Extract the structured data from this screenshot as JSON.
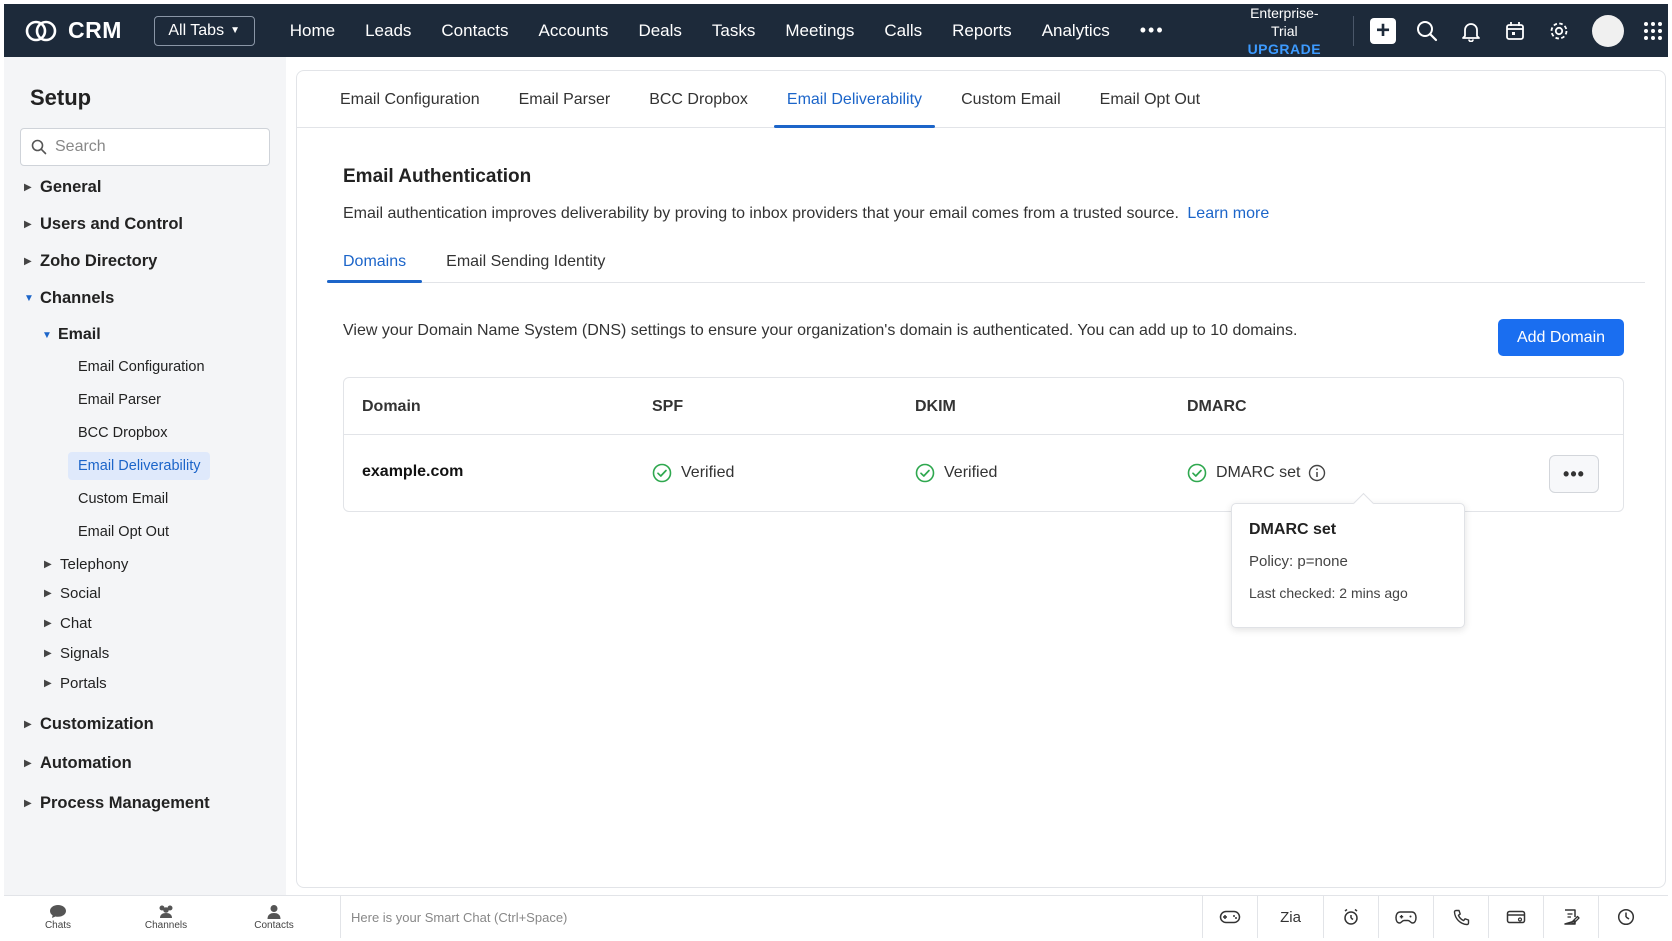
{
  "topbar": {
    "brand": "CRM",
    "all_tabs": "All Tabs",
    "nav": [
      "Home",
      "Leads",
      "Contacts",
      "Accounts",
      "Deals",
      "Tasks",
      "Meetings",
      "Calls",
      "Reports",
      "Analytics"
    ],
    "more": "•••",
    "trial_label": "Enterprise-Trial",
    "upgrade": "UPGRADE"
  },
  "sidebar": {
    "title": "Setup",
    "search_placeholder": "Search",
    "sections": {
      "general": "General",
      "users": "Users and Control",
      "directory": "Zoho Directory",
      "channels": "Channels",
      "email": "Email",
      "email_items": [
        "Email Configuration",
        "Email Parser",
        "BCC Dropbox",
        "Email Deliverability",
        "Custom Email",
        "Email Opt Out"
      ],
      "telephony": "Telephony",
      "social": "Social",
      "chat": "Chat",
      "signals": "Signals",
      "portals": "Portals",
      "customization": "Customization",
      "automation": "Automation",
      "process": "Process Management"
    }
  },
  "main": {
    "tabs": [
      "Email Configuration",
      "Email Parser",
      "BCC Dropbox",
      "Email Deliverability",
      "Custom Email",
      "Email Opt Out"
    ],
    "active_tab": "Email Deliverability",
    "auth_title": "Email Authentication",
    "auth_desc": "Email authentication improves deliverability by proving to inbox providers that your email comes from a trusted source.",
    "learn_more": "Learn more",
    "subtabs": [
      "Domains",
      "Email Sending Identity"
    ],
    "dns_desc": "View your Domain Name System (DNS) settings to ensure your organization's domain is authenticated. You can add up to 10 domains.",
    "add_domain": "Add Domain",
    "table": {
      "headers": [
        "Domain",
        "SPF",
        "DKIM",
        "DMARC"
      ],
      "row": {
        "domain": "example.com",
        "spf": "Verified",
        "dkim": "Verified",
        "dmarc": "DMARC set",
        "menu": "•••"
      }
    },
    "tooltip": {
      "title": "DMARC set",
      "policy": "Policy: p=none",
      "checked": "Last checked: 2 mins ago"
    }
  },
  "bottombar": {
    "chats": "Chats",
    "channels": "Channels",
    "contacts": "Contacts",
    "smart_chat_placeholder": "Here is your Smart Chat (Ctrl+Space)",
    "zia": "Zia"
  },
  "colors": {
    "topbar": "#1d2a3a",
    "accent": "#1c65c9",
    "button": "#1a6ef0",
    "success": "#2fa84f",
    "upgrade": "#3d9bff"
  }
}
